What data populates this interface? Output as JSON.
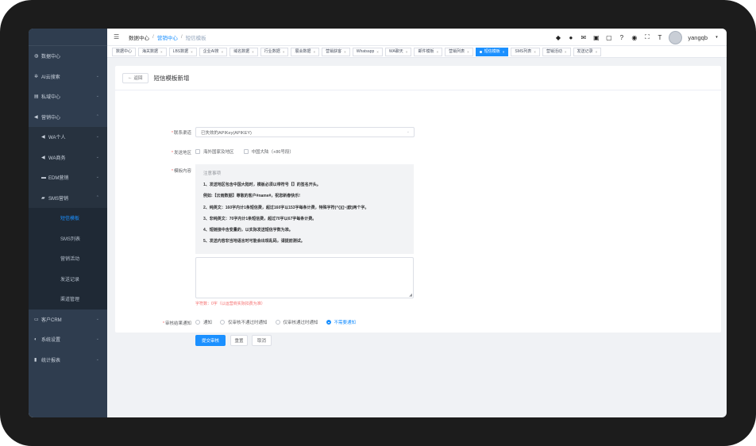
{
  "colors": {
    "accent": "#1b90ff",
    "sidebar": "#2f3d4f",
    "required": "#f56c6c"
  },
  "sidebar": {
    "items": [
      {
        "label": "数据中心",
        "icon": "dashboard-icon"
      },
      {
        "label": "AI云搜索",
        "icon": "ai-search-icon"
      },
      {
        "label": "私域中心",
        "icon": "list-icon"
      },
      {
        "label": "营销中心",
        "icon": "send-icon"
      },
      {
        "label": "WA个人",
        "icon": "send-icon"
      },
      {
        "label": "WA商务",
        "icon": "send-icon"
      },
      {
        "label": "EDM营销",
        "icon": "mail-icon"
      },
      {
        "label": "SMS营销",
        "icon": "sms-icon"
      },
      {
        "label": "短信模板"
      },
      {
        "label": "SMS列表"
      },
      {
        "label": "营销活动"
      },
      {
        "label": "发送记录"
      },
      {
        "label": "渠道管理"
      },
      {
        "label": "客户CRM",
        "icon": "crm-icon"
      },
      {
        "label": "系统设置",
        "icon": "settings-icon"
      },
      {
        "label": "统计报表",
        "icon": "chart-icon"
      }
    ]
  },
  "breadcrumb": {
    "home": "数据中心",
    "parent": "营销中心",
    "current": "短信模板",
    "sep": "/"
  },
  "user": {
    "name": "yangqb"
  },
  "tags": [
    "数据中心",
    "海关数据",
    "LBS数据",
    "企业AI搜",
    "域名数据",
    "行业数据",
    "展会数据",
    "营销获客",
    "Whatsapp",
    "WA聊天",
    "邮件模板",
    "营销列表",
    "短信模板",
    "SMS列表",
    "营销活动",
    "发送记录"
  ],
  "page": {
    "back_label": "返回",
    "back_arrow": "←",
    "title": "短信模板新增",
    "channel_label": "联系渠道",
    "channel_value": "已失效的APIKey(APIKEY)",
    "region_label": "发送地区",
    "region_overseas": "海外国家及地区",
    "region_china": "中国大陆（+86号段）",
    "content_label": "模板内容",
    "notice_title": "注意事项",
    "notice_lines": [
      "1、发送地区包含中国大陆时，模板必须以带符号【】的签名开头。",
      "例如:【云雨数据】尊敬的客户#name#，祝您新春快乐!",
      "2、纯英文：160字内计1条短信费，超过160字以153字每条计费，特殊字符(^{}[]~|欧)两个字。",
      "3、非纯英文：70字内计1条短信费，超过70字以67字每条计费。",
      "4、短链接中含变量的，以实际发送短信字数为准。",
      "5、发送内容非当地语言时可能会出现乱码，请提前测试。"
    ],
    "char_count": "字符数：0字（以运营商实际扣费为准）",
    "review_label": "审核结果通知",
    "review_options": [
      "通知",
      "仅审核不通过时通知",
      "仅审核通过时通知",
      "不需要通知"
    ],
    "submit_label": "提交审核",
    "reset_label": "重置",
    "cancel_label": "取消"
  },
  "icons": {
    "hamburger": "☰",
    "chevron": "⌄",
    "required": "*"
  }
}
